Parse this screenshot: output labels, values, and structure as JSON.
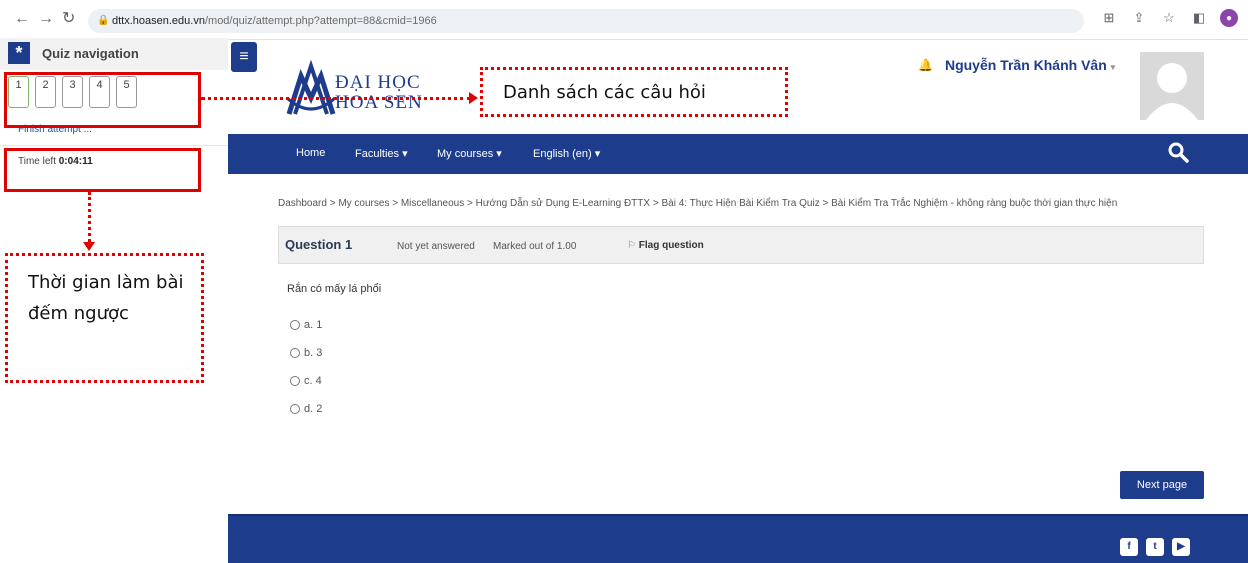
{
  "browser": {
    "url_host": "dttx.hoasen.edu.vn",
    "url_path": "/mod/quiz/attempt.php?attempt=88&cmid=1966",
    "profile_initial": "●"
  },
  "drawer": {
    "title": "Quiz navigation",
    "question_buttons": [
      "1",
      "2",
      "3",
      "4",
      "5"
    ],
    "finish_link": "Finish attempt ...",
    "time_left_label": "Time left",
    "time_left_value": "0:04:11"
  },
  "annotations": {
    "question_list_callout": "Danh sách các câu hỏi",
    "timer_callout": "Thời gian làm bài đếm ngược",
    "color": "#e00000"
  },
  "header": {
    "logo_line1": "ĐẠI HỌC",
    "logo_line2": "HOA SEN",
    "user_name": "Nguyễn Trần Khánh Vân",
    "user_caret": "▾"
  },
  "navbar": {
    "items": [
      "Home",
      "Faculties ▾",
      "My courses ▾",
      "English (en) ▾"
    ]
  },
  "breadcrumb": "Dashboard > My courses > Miscellaneous > Hướng Dẫn sử Dụng E-Learning ĐTTX > Bài 4: Thực Hiện Bài Kiểm Tra Quiz > Bài Kiểm Tra Trắc Nghiệm - không ràng buộc thời gian thực hiện",
  "question": {
    "number_label": "Question 1",
    "state": "Not yet answered",
    "marked": "Marked out of 1.00",
    "flag_label": "Flag question",
    "text": "Rắn có mấy lá phổi",
    "answers": [
      "a.  1",
      "b.  3",
      "c.  4",
      "d.  2"
    ]
  },
  "next_button": "Next page",
  "colors": {
    "brand": "#1e3c8c",
    "annotation_red": "#e00000"
  }
}
